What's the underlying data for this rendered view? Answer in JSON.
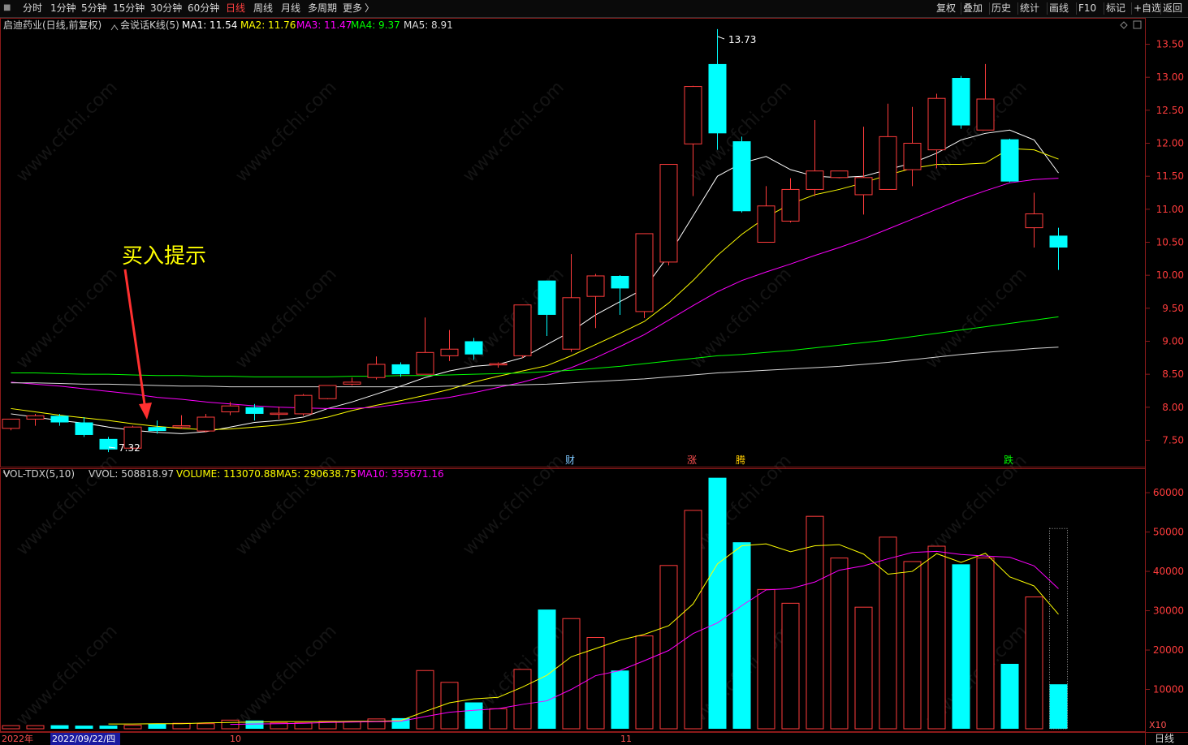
{
  "toolbar": {
    "periods": [
      "分时",
      "1分钟",
      "5分钟",
      "15分钟",
      "30分钟",
      "60分钟",
      "日线",
      "周线",
      "月线",
      "多周期",
      "更多"
    ],
    "active_period": "日线",
    "right_buttons": [
      "复权",
      "叠加",
      "历史",
      "统计",
      "画线",
      "F10",
      "标记",
      "+自选",
      "返回"
    ]
  },
  "header": {
    "stock": "启迪药业(日线,前复权)",
    "indicator": "会说话K线(5)",
    "ma1": "MA1: 11.54",
    "ma2": "MA2: 11.76",
    "ma3": "MA3: 11.47",
    "ma4": "MA4: 9.37",
    "ma5": "MA5: 8.91"
  },
  "vol_header": {
    "name": "VOL-TDX(5,10)",
    "vvol": "VVOL: 508818.97",
    "volume": "VOLUME: 113070.88",
    "ma5": "MA5: 290638.75",
    "ma10": "MA10: 355671.16"
  },
  "annotation": {
    "buy_hint": "买入提示"
  },
  "labels": {
    "high": "13.73",
    "low": "7.32",
    "vol_unit": "X10",
    "period_corner": "日线"
  },
  "markers": [
    "财",
    "涨",
    "腾",
    "跌"
  ],
  "date_axis": {
    "year": "2022年",
    "cursor_date": "2022/09/22/四",
    "m10": "10",
    "m11": "11"
  },
  "colors": {
    "up": "#ff3c3c",
    "down": "#00ffff",
    "ma1": "#ffffff",
    "ma2": "#ffff00",
    "ma3": "#ff00ff",
    "ma4": "#00ff00",
    "ma5": "#d8d8d8",
    "buy_hint": "#ffff00"
  },
  "chart_data": [
    {
      "type": "candlestick",
      "y_ticks": [
        13.5,
        13.0,
        12.5,
        12.0,
        11.5,
        11.0,
        10.5,
        10.0,
        9.5,
        9.0,
        8.5,
        8.0,
        7.5
      ],
      "ylim": [
        7.1,
        13.9
      ],
      "candles": [
        {
          "o": 7.68,
          "h": 7.8,
          "l": 7.65,
          "c": 7.82
        },
        {
          "o": 7.82,
          "h": 7.9,
          "l": 7.72,
          "c": 7.87
        },
        {
          "o": 7.87,
          "h": 7.9,
          "l": 7.72,
          "c": 7.77
        },
        {
          "o": 7.77,
          "h": 7.85,
          "l": 7.55,
          "c": 7.58
        },
        {
          "o": 7.52,
          "h": 7.55,
          "l": 7.32,
          "c": 7.36
        },
        {
          "o": 7.38,
          "h": 7.72,
          "l": 7.35,
          "c": 7.7
        },
        {
          "o": 7.7,
          "h": 7.8,
          "l": 7.6,
          "c": 7.64
        },
        {
          "o": 7.7,
          "h": 7.88,
          "l": 7.67,
          "c": 7.72
        },
        {
          "o": 7.64,
          "h": 7.9,
          "l": 7.62,
          "c": 7.85
        },
        {
          "o": 7.93,
          "h": 8.08,
          "l": 7.88,
          "c": 8.02
        },
        {
          "o": 8.0,
          "h": 8.05,
          "l": 7.8,
          "c": 7.9
        },
        {
          "o": 7.9,
          "h": 8.01,
          "l": 7.82,
          "c": 7.91
        },
        {
          "o": 7.9,
          "h": 8.2,
          "l": 7.87,
          "c": 8.18
        },
        {
          "o": 8.13,
          "h": 8.33,
          "l": 8.12,
          "c": 8.33
        },
        {
          "o": 8.35,
          "h": 8.45,
          "l": 8.33,
          "c": 8.38
        },
        {
          "o": 8.45,
          "h": 8.77,
          "l": 8.42,
          "c": 8.65
        },
        {
          "o": 8.65,
          "h": 8.68,
          "l": 8.46,
          "c": 8.5
        },
        {
          "o": 8.5,
          "h": 9.36,
          "l": 8.5,
          "c": 8.83
        },
        {
          "o": 8.78,
          "h": 9.17,
          "l": 8.7,
          "c": 8.88
        },
        {
          "o": 9.0,
          "h": 9.05,
          "l": 8.72,
          "c": 8.8
        },
        {
          "o": 8.65,
          "h": 8.68,
          "l": 8.6,
          "c": 8.66
        },
        {
          "o": 8.78,
          "h": 9.55,
          "l": 8.75,
          "c": 9.55
        },
        {
          "o": 9.92,
          "h": 9.92,
          "l": 9.08,
          "c": 9.4
        },
        {
          "o": 8.88,
          "h": 10.32,
          "l": 8.84,
          "c": 9.66
        },
        {
          "o": 9.68,
          "h": 10.02,
          "l": 9.2,
          "c": 9.99
        },
        {
          "o": 9.99,
          "h": 10.0,
          "l": 9.4,
          "c": 9.8
        },
        {
          "o": 9.45,
          "h": 10.63,
          "l": 9.35,
          "c": 10.63
        },
        {
          "o": 10.2,
          "h": 11.68,
          "l": 10.15,
          "c": 11.68
        },
        {
          "o": 11.99,
          "h": 12.87,
          "l": 11.2,
          "c": 12.86
        },
        {
          "o": 13.2,
          "h": 13.73,
          "l": 11.9,
          "c": 12.15
        },
        {
          "o": 12.03,
          "h": 12.1,
          "l": 10.95,
          "c": 10.97
        },
        {
          "o": 10.5,
          "h": 11.35,
          "l": 10.5,
          "c": 11.05
        },
        {
          "o": 10.82,
          "h": 11.47,
          "l": 10.8,
          "c": 11.3
        },
        {
          "o": 11.3,
          "h": 12.35,
          "l": 11.2,
          "c": 11.58
        },
        {
          "o": 11.48,
          "h": 11.58,
          "l": 11.47,
          "c": 11.58
        },
        {
          "o": 11.22,
          "h": 12.25,
          "l": 10.92,
          "c": 11.48
        },
        {
          "o": 11.3,
          "h": 12.6,
          "l": 11.3,
          "c": 12.1
        },
        {
          "o": 11.6,
          "h": 12.55,
          "l": 11.35,
          "c": 12.0
        },
        {
          "o": 11.9,
          "h": 12.75,
          "l": 11.62,
          "c": 12.68
        },
        {
          "o": 12.99,
          "h": 13.02,
          "l": 12.22,
          "c": 12.27
        },
        {
          "o": 12.2,
          "h": 13.2,
          "l": 12.2,
          "c": 12.67
        },
        {
          "o": 12.06,
          "h": 12.07,
          "l": 11.41,
          "c": 11.42
        },
        {
          "o": 10.72,
          "h": 11.25,
          "l": 10.42,
          "c": 10.93
        },
        {
          "o": 10.6,
          "h": 10.72,
          "l": 10.08,
          "c": 10.42
        }
      ],
      "ma_series": [
        {
          "name": "MA1",
          "values": [
            7.9,
            7.85,
            7.8,
            7.76,
            7.7,
            7.65,
            7.62,
            7.6,
            7.63,
            7.7,
            7.77,
            7.8,
            7.85,
            7.98,
            8.08,
            8.2,
            8.32,
            8.45,
            8.55,
            8.62,
            8.65,
            8.75,
            8.95,
            9.15,
            9.4,
            9.6,
            9.8,
            10.3,
            10.9,
            11.5,
            11.7,
            11.8,
            11.6,
            11.5,
            11.48,
            11.5,
            11.6,
            11.7,
            11.85,
            12.05,
            12.15,
            12.2,
            12.05,
            11.55
          ]
        },
        {
          "name": "MA2",
          "values": [
            7.98,
            7.93,
            7.88,
            7.84,
            7.8,
            7.75,
            7.71,
            7.68,
            7.66,
            7.67,
            7.7,
            7.73,
            7.78,
            7.85,
            7.95,
            8.03,
            8.1,
            8.18,
            8.27,
            8.38,
            8.47,
            8.55,
            8.63,
            8.78,
            8.95,
            9.12,
            9.3,
            9.58,
            9.92,
            10.3,
            10.62,
            10.88,
            11.08,
            11.22,
            11.3,
            11.4,
            11.52,
            11.62,
            11.68,
            11.68,
            11.7,
            11.92,
            11.9,
            11.76
          ]
        },
        {
          "name": "MA3",
          "values": [
            8.38,
            8.35,
            8.32,
            8.28,
            8.24,
            8.2,
            8.15,
            8.12,
            8.08,
            8.05,
            8.02,
            8.0,
            7.99,
            7.98,
            7.98,
            8.0,
            8.05,
            8.1,
            8.15,
            8.22,
            8.3,
            8.38,
            8.48,
            8.6,
            8.75,
            8.92,
            9.1,
            9.32,
            9.54,
            9.75,
            9.92,
            10.05,
            10.17,
            10.3,
            10.42,
            10.55,
            10.7,
            10.85,
            11.0,
            11.15,
            11.28,
            11.4,
            11.45,
            11.47
          ]
        },
        {
          "name": "MA4",
          "values": [
            8.52,
            8.52,
            8.51,
            8.5,
            8.5,
            8.49,
            8.48,
            8.48,
            8.47,
            8.47,
            8.46,
            8.46,
            8.46,
            8.46,
            8.47,
            8.47,
            8.48,
            8.48,
            8.49,
            8.5,
            8.51,
            8.52,
            8.54,
            8.56,
            8.59,
            8.62,
            8.66,
            8.7,
            8.74,
            8.78,
            8.8,
            8.83,
            8.86,
            8.9,
            8.94,
            8.98,
            9.02,
            9.07,
            9.12,
            9.17,
            9.22,
            9.27,
            9.32,
            9.37
          ]
        },
        {
          "name": "MA5",
          "values": [
            8.37,
            8.37,
            8.36,
            8.35,
            8.35,
            8.34,
            8.33,
            8.32,
            8.32,
            8.31,
            8.31,
            8.31,
            8.31,
            8.31,
            8.31,
            8.31,
            8.31,
            8.31,
            8.32,
            8.32,
            8.33,
            8.34,
            8.35,
            8.37,
            8.39,
            8.41,
            8.43,
            8.46,
            8.49,
            8.52,
            8.54,
            8.56,
            8.58,
            8.6,
            8.62,
            8.65,
            8.68,
            8.72,
            8.76,
            8.8,
            8.83,
            8.86,
            8.89,
            8.91
          ]
        }
      ]
    },
    {
      "type": "bar",
      "title": "VOL-TDX(5,10)",
      "y_ticks": [
        60000,
        50000,
        40000,
        30000,
        20000,
        10000
      ],
      "ylim": [
        0,
        66000
      ],
      "volumes": [
        800,
        800,
        900,
        800,
        800,
        900,
        1300,
        1400,
        1300,
        2200,
        2100,
        1500,
        1500,
        1900,
        1800,
        2500,
        2700,
        14800,
        11800,
        6700,
        5100,
        15100,
        30300,
        28000,
        23200,
        14800,
        23600,
        41500,
        55500,
        63800,
        47400,
        35400,
        31900,
        54000,
        43400,
        30900,
        48700,
        42500,
        46400,
        41800,
        43400,
        16500,
        33500,
        11307
      ],
      "volume_outline": 50882,
      "ma5": [
        null,
        null,
        null,
        null,
        1200,
        1200,
        1300,
        1300,
        1500,
        1600,
        1700,
        1800,
        1800,
        1800,
        1900,
        1900,
        2100,
        4400,
        6600,
        7600,
        8000,
        10600,
        13600,
        18300,
        20400,
        22500,
        24000,
        26200,
        31700,
        41900,
        46500,
        47000,
        45000,
        46500,
        46800,
        44400,
        39300,
        40000,
        44500,
        42300,
        44600,
        38600,
        36300,
        29100
      ],
      "ma10": [
        null,
        null,
        null,
        null,
        null,
        null,
        null,
        null,
        null,
        1100,
        1200,
        1300,
        1400,
        1600,
        1700,
        1800,
        1900,
        3100,
        4200,
        4700,
        5100,
        6200,
        7100,
        10000,
        13500,
        14800,
        17300,
        19900,
        24200,
        26900,
        31300,
        35300,
        35600,
        37300,
        40300,
        41400,
        43200,
        44800,
        45100,
        44300,
        43900,
        43600,
        41400,
        35600
      ]
    }
  ]
}
